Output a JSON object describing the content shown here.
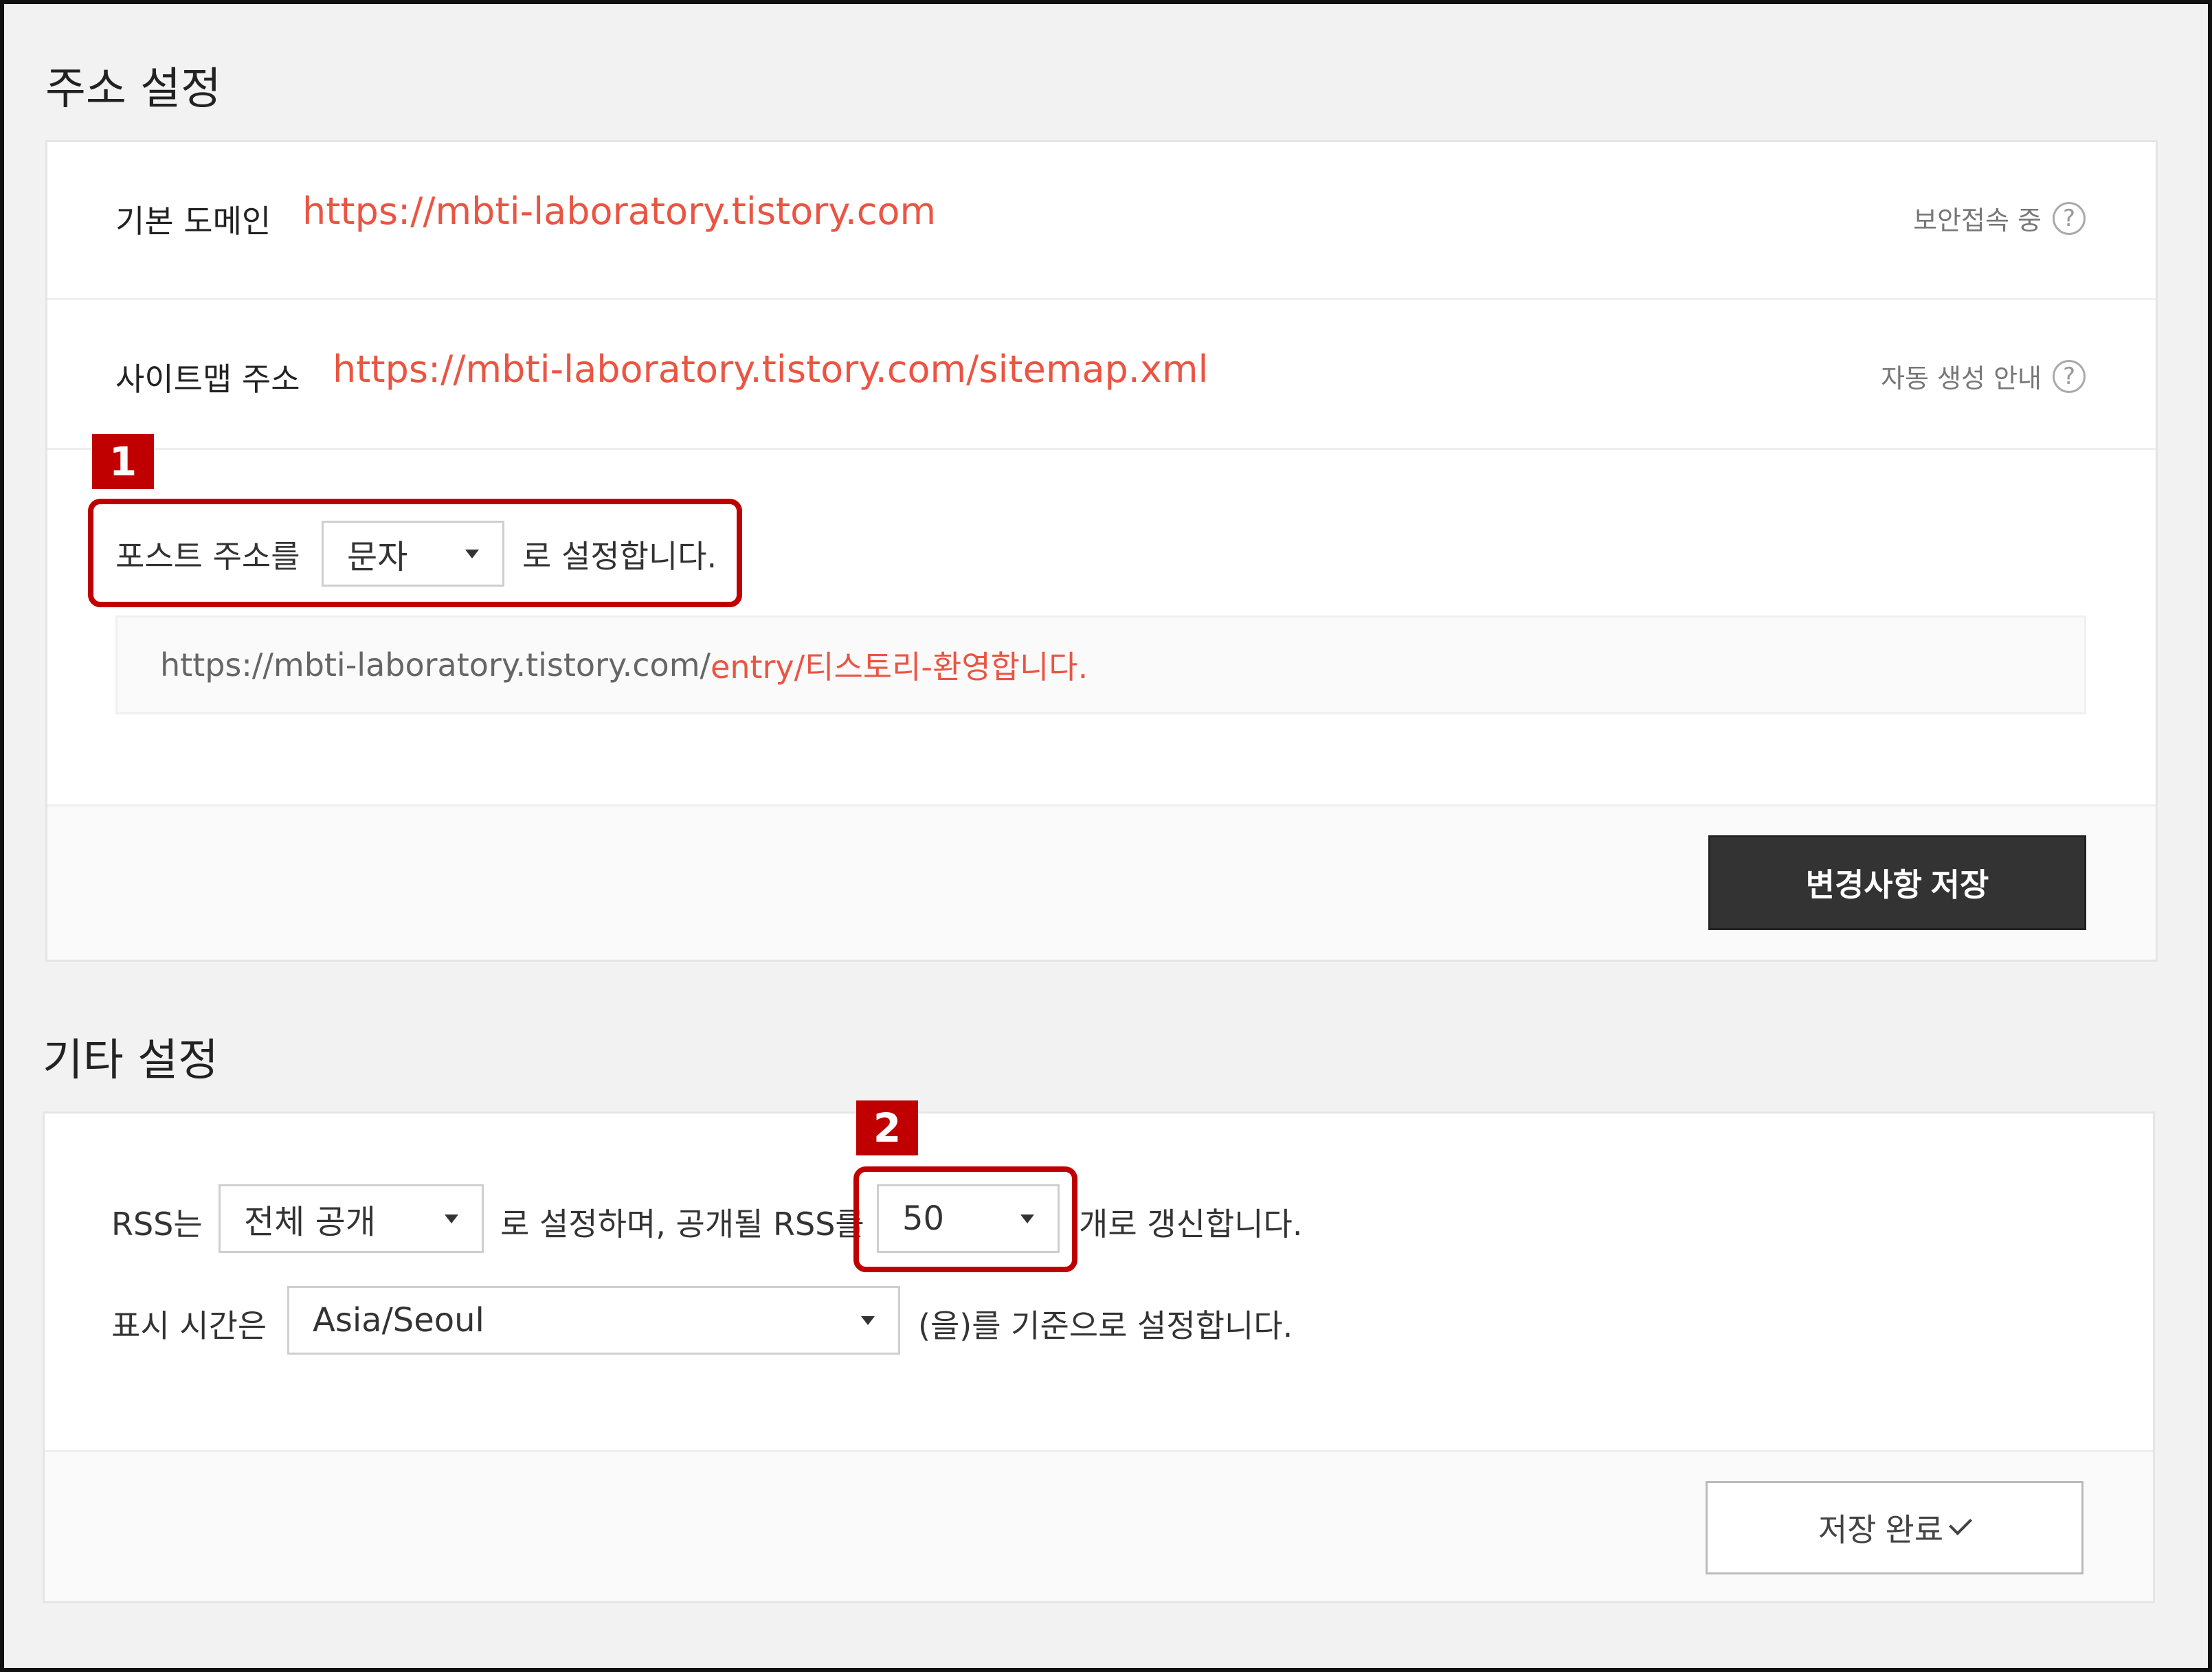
{
  "address_section": {
    "title": "주소 설정",
    "default_domain": {
      "label": "기본 도메인",
      "url": "https://mbti-laboratory.tistory.com",
      "help": "보안접속 중"
    },
    "sitemap": {
      "label": "사이트맵 주소",
      "url": "https://mbti-laboratory.tistory.com/sitemap.xml",
      "help": "자동 생성 안내"
    },
    "post_address": {
      "prefix": "포스트 주소를",
      "select_value": "문자",
      "suffix": "로 설정합니다."
    },
    "preview": {
      "base": "https://mbti-laboratory.tistory.com/",
      "path": "entry/티스토리-환영합니다."
    },
    "save_button": "변경사항 저장"
  },
  "other_section": {
    "title": "기타 설정",
    "rss": {
      "prefix": "RSS는",
      "visibility_value": "전체 공개",
      "middle": "로 설정하며, 공개될 RSS를",
      "count_value": "50",
      "suffix": "개로 갱신합니다."
    },
    "timezone": {
      "prefix": "표시 시간은",
      "value": "Asia/Seoul",
      "suffix": "(을)를 기준으로 설정합니다."
    },
    "save_button": "저장 완료"
  },
  "annotations": {
    "badge_1": "1",
    "badge_2": "2"
  },
  "help_icon_glyph": "?",
  "colors": {
    "link": "#ea5543",
    "annotation": "#c00000",
    "dark_button": "#333333"
  }
}
